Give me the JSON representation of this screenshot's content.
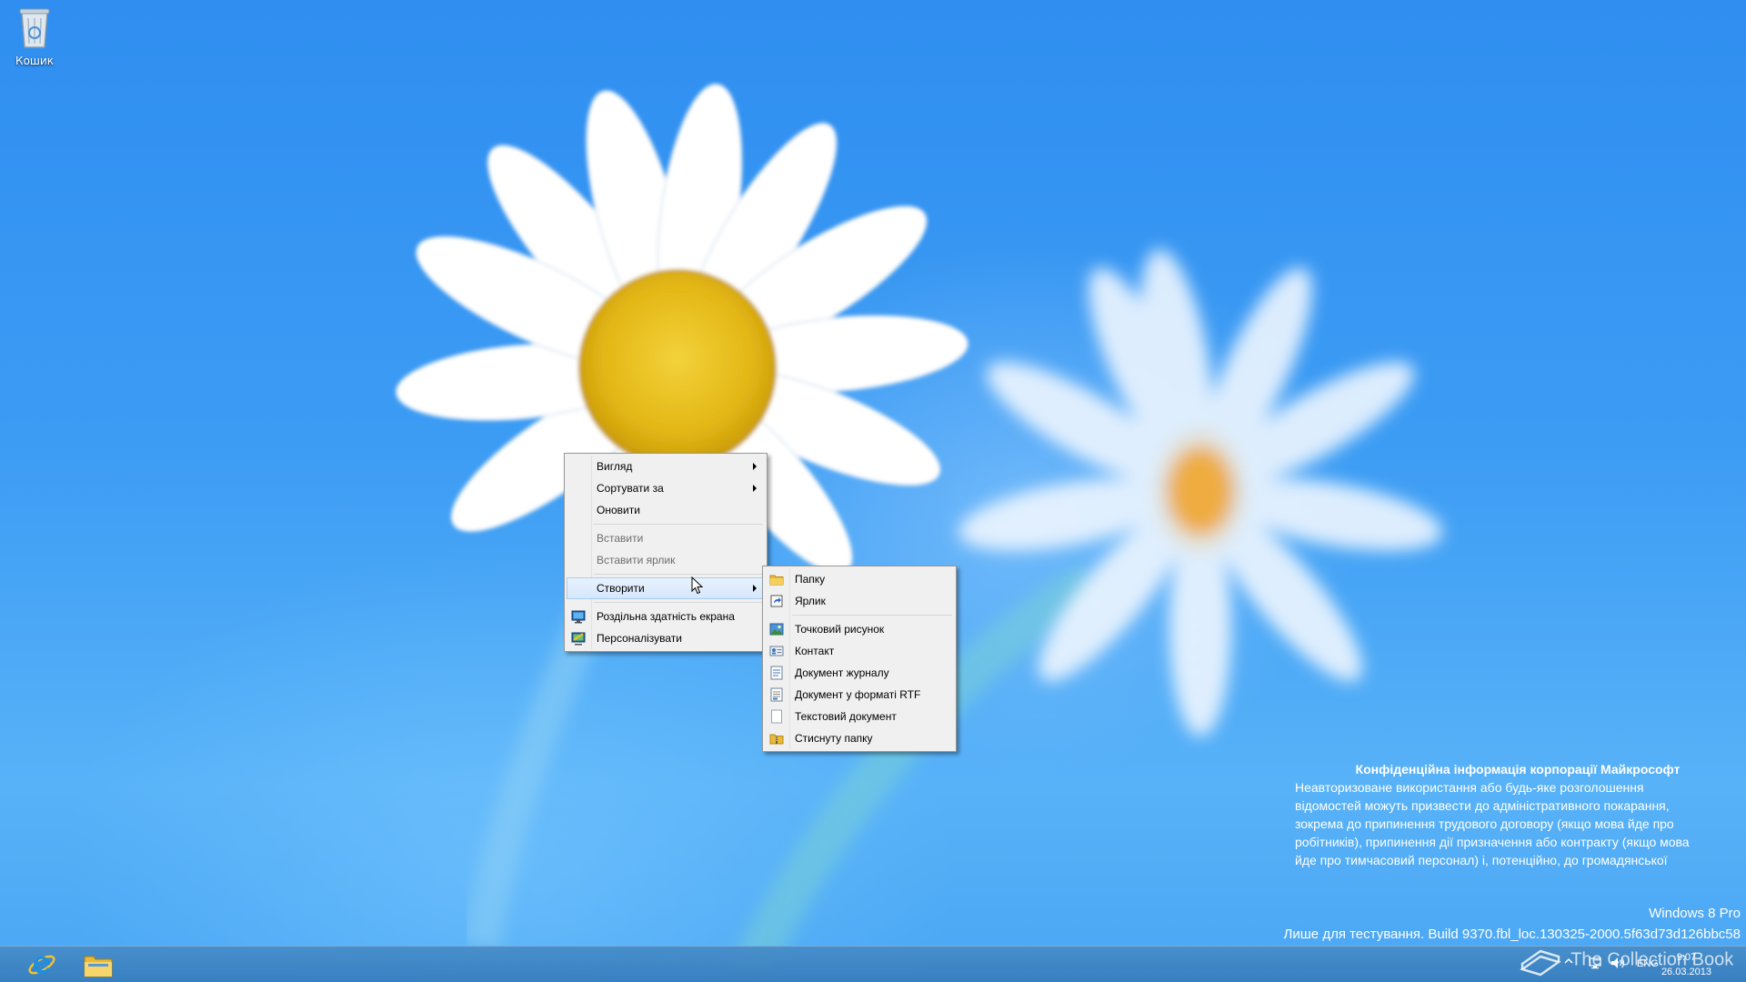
{
  "desktop": {
    "icons": [
      {
        "label": "Кошик",
        "icon": "recycle-bin-icon"
      }
    ]
  },
  "context_menu": {
    "items": [
      {
        "label": "Вигляд",
        "has_submenu": true
      },
      {
        "label": "Сортувати за",
        "has_submenu": true
      },
      {
        "label": "Оновити"
      },
      {
        "label": "Вставити",
        "disabled": true
      },
      {
        "label": "Вставити ярлик",
        "disabled": true
      },
      {
        "label": "Створити",
        "has_submenu": true,
        "highlighted": true
      },
      {
        "label": "Роздільна здатність екрана",
        "icon": "display-settings-icon"
      },
      {
        "label": "Персоналізувати",
        "icon": "personalize-icon"
      }
    ]
  },
  "submenu_new": {
    "items": [
      {
        "label": "Папку",
        "icon": "folder-icon"
      },
      {
        "label": "Ярлик",
        "icon": "shortcut-icon"
      },
      {
        "label": "Точковий рисунок",
        "icon": "bitmap-icon"
      },
      {
        "label": "Контакт",
        "icon": "contact-icon"
      },
      {
        "label": "Документ журналу",
        "icon": "journal-icon"
      },
      {
        "label": "Документ у форматі RTF",
        "icon": "rtf-icon"
      },
      {
        "label": "Текстовий документ",
        "icon": "text-doc-icon"
      },
      {
        "label": "Стиснуту папку",
        "icon": "zip-folder-icon"
      }
    ]
  },
  "watermark": {
    "title": "Конфіденційна інформація корпорації Майкрософт",
    "lines": [
      "Неавторизоване використання або будь-яке розголошення",
      "відомостей можуть призвести до адміністративного покарання,",
      "зокрема до припинення трудового договору (якщо мова йде про",
      "робітників), припинення дії призначення або контракту (якщо мова",
      "йде про тимчасовий персонал) і, потенційно, до громадянської"
    ],
    "os": "Windows 8 Pro",
    "build": "Лише для тестування. Build 9370.fbl_loc.130325-2000.5f63d73d126bbc58",
    "collection": "The Collection Book"
  },
  "taskbar": {
    "pinned": [
      {
        "name": "Internet Explorer",
        "icon": "internet-explorer-icon"
      },
      {
        "name": "File Explorer",
        "icon": "file-explorer-icon"
      }
    ],
    "tray": {
      "language": "ENG",
      "time": "9:07",
      "date": "26.03.2013"
    }
  },
  "colors": {
    "menu_bg": "#f0f0f0",
    "menu_highlight": "#d5e7fb",
    "taskbar": "#3f82c2",
    "wallpaper": "#3c9cf4"
  }
}
